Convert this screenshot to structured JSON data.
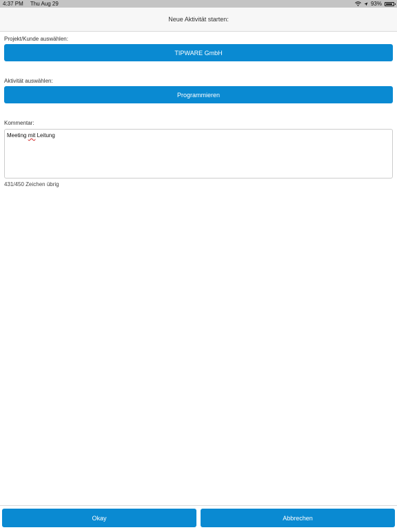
{
  "status_bar": {
    "time": "4:37 PM",
    "date": "Thu Aug 29",
    "battery": "93%",
    "battery_level": 0.93
  },
  "header": {
    "title": "Neue Aktivität starten:"
  },
  "project": {
    "label": "Projekt/Kunde auswählen:",
    "value": "TIPWARE GmbH"
  },
  "activity": {
    "label": "Aktivität auswählen:",
    "value": "Programmieren"
  },
  "comment": {
    "label": "Kommentar:",
    "text_before": "Meeting ",
    "text_misspelled": "mit",
    "text_after": " Leitung",
    "counter": "431/450 Zeichen übrig"
  },
  "footer": {
    "okay_label": "Okay",
    "cancel_label": "Abbrechen"
  },
  "colors": {
    "accent": "#0a8ad2",
    "status_bar": "#c4c4c4"
  }
}
